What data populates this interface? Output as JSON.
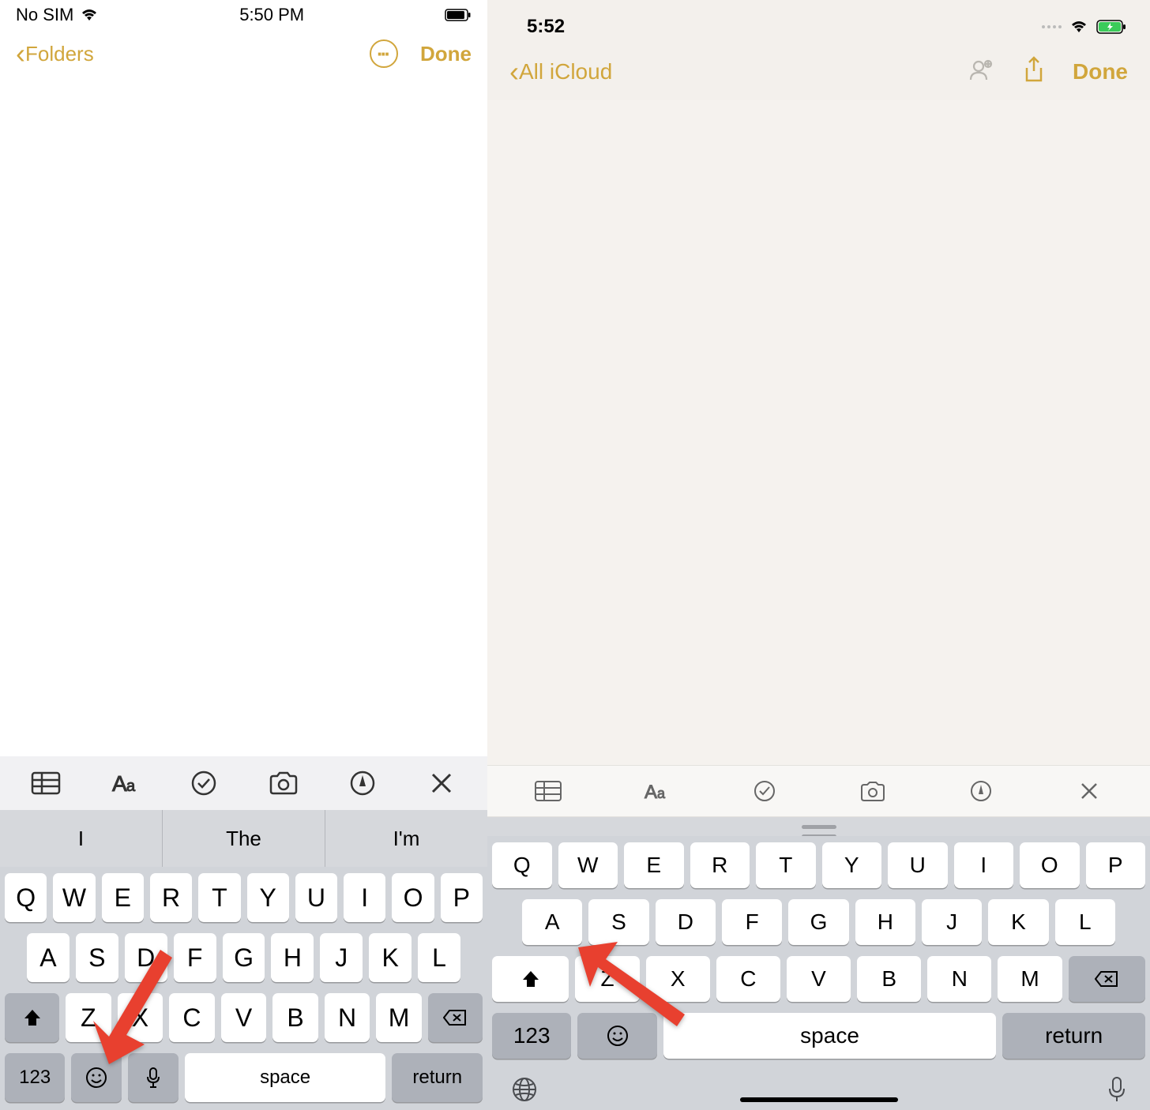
{
  "left": {
    "status": {
      "carrier": "No SIM",
      "time": "5:50 PM"
    },
    "nav": {
      "back": "Folders",
      "done": "Done"
    },
    "predictions": [
      "I",
      "The",
      "I'm"
    ],
    "keyboard": {
      "row1": [
        "Q",
        "W",
        "E",
        "R",
        "T",
        "Y",
        "U",
        "I",
        "O",
        "P"
      ],
      "row2": [
        "A",
        "S",
        "D",
        "F",
        "G",
        "H",
        "J",
        "K",
        "L"
      ],
      "row3": [
        "Z",
        "X",
        "C",
        "V",
        "B",
        "N",
        "M"
      ],
      "num": "123",
      "space": "space",
      "return": "return"
    }
  },
  "right": {
    "status": {
      "time": "5:52"
    },
    "nav": {
      "back": "All iCloud",
      "done": "Done"
    },
    "keyboard": {
      "row1": [
        "Q",
        "W",
        "E",
        "R",
        "T",
        "Y",
        "U",
        "I",
        "O",
        "P"
      ],
      "row2": [
        "A",
        "S",
        "D",
        "F",
        "G",
        "H",
        "J",
        "K",
        "L"
      ],
      "row3": [
        "Z",
        "X",
        "C",
        "V",
        "B",
        "N",
        "M"
      ],
      "num": "123",
      "space": "space",
      "return": "return"
    }
  }
}
